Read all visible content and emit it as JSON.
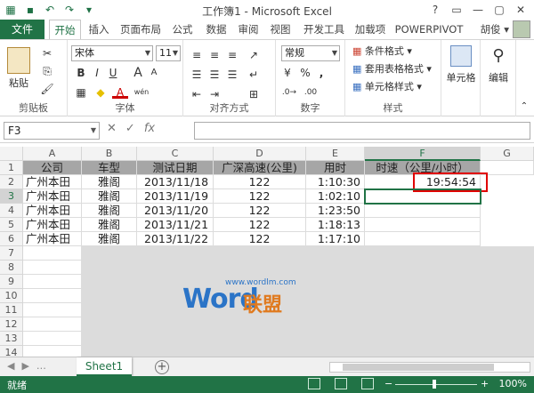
{
  "window": {
    "title": "工作簿1 - Microsoft Excel",
    "qat_icons": [
      "excel-icon",
      "save-icon",
      "undo-icon",
      "redo-icon",
      "customize-icon"
    ],
    "controls": [
      "?",
      "▭",
      "—",
      "▢",
      "✕"
    ]
  },
  "tabs": {
    "file": "文件",
    "items": [
      "开始",
      "插入",
      "页面布局",
      "公式",
      "数据",
      "审阅",
      "视图",
      "开发工具",
      "加载项",
      "POWERPIVOT"
    ],
    "active": "开始",
    "user": "胡俊 ▾"
  },
  "ribbon": {
    "clipboard": {
      "label": "剪贴板",
      "paste": "粘贴"
    },
    "font": {
      "label": "字体",
      "name": "宋体",
      "size": "11",
      "bold": "B",
      "italic": "I",
      "underline": "U",
      "wen": "wén",
      "a_color": "A"
    },
    "alignment": {
      "label": "对齐方式"
    },
    "number": {
      "label": "数字",
      "format": "常规",
      "percent": "%",
      "comma": ",",
      "pct_arrow": "▾"
    },
    "styles": {
      "label": "样式",
      "cond": "条件格式 ▾",
      "table": "套用表格格式 ▾",
      "cell": "单元格样式 ▾"
    },
    "cells": {
      "label": "单元格"
    },
    "editing": {
      "label": "编辑"
    }
  },
  "formula_bar": {
    "name_box": "F3",
    "icons": [
      "✕",
      "✓",
      "fx"
    ],
    "value": ""
  },
  "columns": [
    "A",
    "B",
    "C",
    "D",
    "E",
    "F",
    "G"
  ],
  "rows": [
    "1",
    "2",
    "3",
    "4",
    "5",
    "6",
    "7",
    "8",
    "9",
    "10",
    "11",
    "12",
    "13",
    "14"
  ],
  "table": {
    "headers": [
      "公司",
      "车型",
      "测试日期",
      "广深高速(公里)",
      "用时",
      "时速（公里/小时）"
    ],
    "data": [
      [
        "广州本田",
        "雅阁",
        "2013/11/18",
        "122",
        "1:10:30",
        "19:54:54"
      ],
      [
        "广州本田",
        "雅阁",
        "2013/11/19",
        "122",
        "1:02:10",
        ""
      ],
      [
        "广州本田",
        "雅阁",
        "2013/11/20",
        "122",
        "1:23:50",
        ""
      ],
      [
        "广州本田",
        "雅阁",
        "2013/11/21",
        "122",
        "1:18:13",
        ""
      ],
      [
        "广州本田",
        "雅阁",
        "2013/11/22",
        "122",
        "1:17:10",
        ""
      ]
    ]
  },
  "sheets": {
    "active": "Sheet1",
    "add": "+"
  },
  "status": {
    "ready": "就绪",
    "zoom": "100%"
  },
  "watermark": {
    "url": "www.wordlm.com",
    "word": "Word",
    "cn": "联盟"
  }
}
